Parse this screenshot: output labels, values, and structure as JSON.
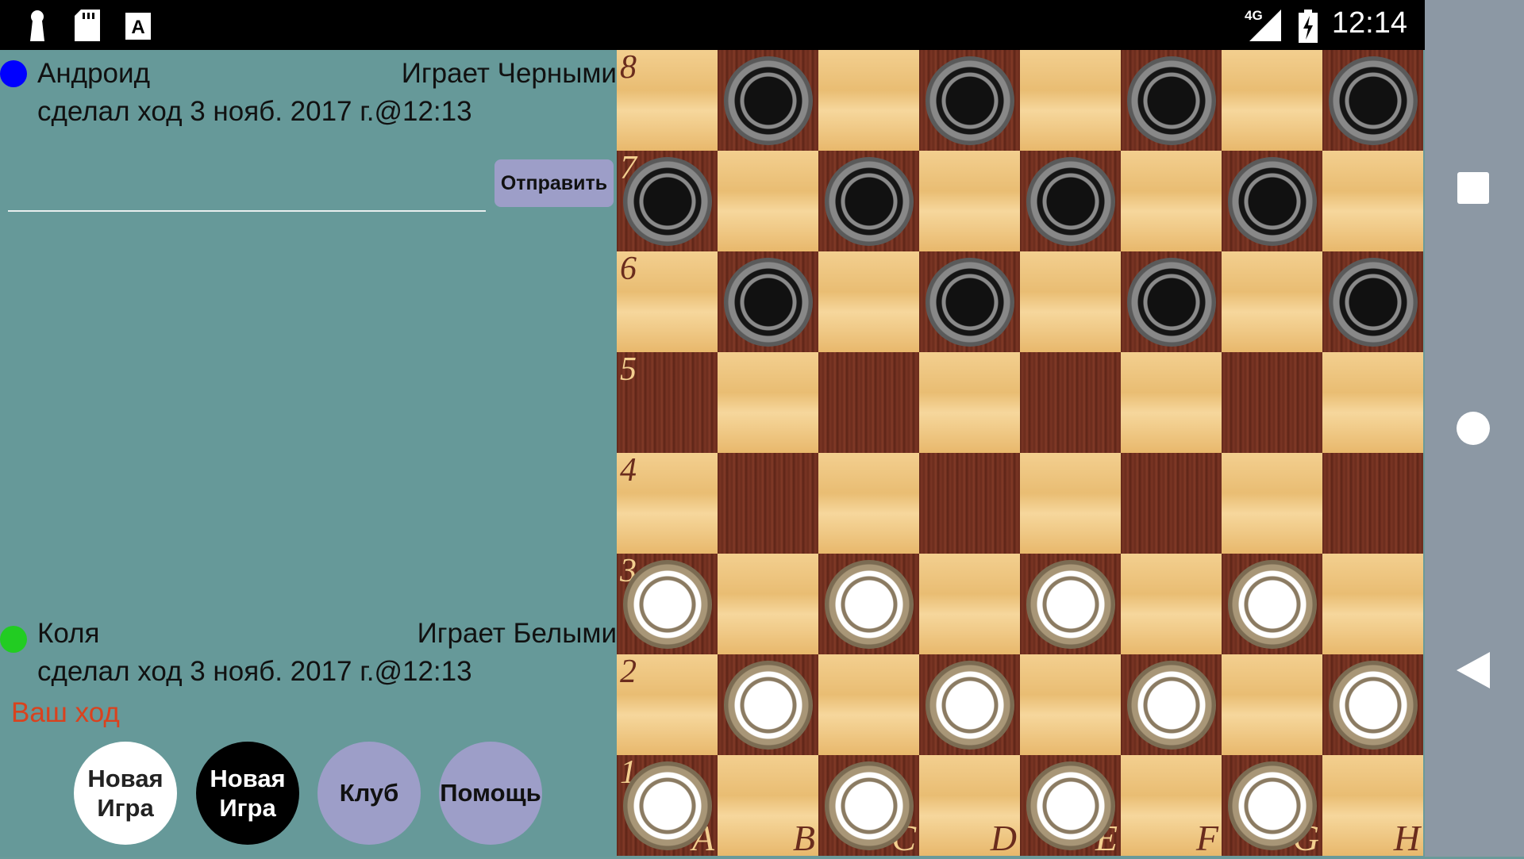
{
  "status_bar": {
    "time": "12:14",
    "network": "4G",
    "icons": [
      "keyhole-icon",
      "sd-card-icon",
      "font-a-icon",
      "signal-icon",
      "battery-charging-icon"
    ]
  },
  "nav_bar": {
    "icons": [
      "square-recent-icon",
      "circle-home-icon",
      "triangle-back-icon"
    ]
  },
  "opponent": {
    "name": "Андроид",
    "color_text": "Играет Черными",
    "last_move": "сделал ход 3 нояб. 2017 г.@12:13",
    "dot_color": "#0000ff"
  },
  "chat": {
    "input_value": "",
    "send_label": "Отправить"
  },
  "player": {
    "name": "Коля",
    "color_text": "Играет Белыми",
    "last_move": "сделал ход 3 нояб. 2017 г.@12:13",
    "dot_color": "#22cc22",
    "turn_text": "Ваш ход"
  },
  "buttons": {
    "new_game_white": [
      "Новая",
      "Игра"
    ],
    "new_game_black": [
      "Новая",
      "Игра"
    ],
    "club": "Клуб",
    "help": "Помощь"
  },
  "board": {
    "ranks": [
      "8",
      "7",
      "6",
      "5",
      "4",
      "3",
      "2",
      "1"
    ],
    "files": [
      "A",
      "B",
      "C",
      "D",
      "E",
      "F",
      "G",
      "H"
    ],
    "pieces": [
      {
        "sq": "b8",
        "color": "black"
      },
      {
        "sq": "d8",
        "color": "black"
      },
      {
        "sq": "f8",
        "color": "black"
      },
      {
        "sq": "h8",
        "color": "black"
      },
      {
        "sq": "a7",
        "color": "black"
      },
      {
        "sq": "c7",
        "color": "black"
      },
      {
        "sq": "e7",
        "color": "black"
      },
      {
        "sq": "g7",
        "color": "black"
      },
      {
        "sq": "b6",
        "color": "black"
      },
      {
        "sq": "d6",
        "color": "black"
      },
      {
        "sq": "f6",
        "color": "black"
      },
      {
        "sq": "h6",
        "color": "black"
      },
      {
        "sq": "a3",
        "color": "white"
      },
      {
        "sq": "c3",
        "color": "white"
      },
      {
        "sq": "e3",
        "color": "white"
      },
      {
        "sq": "g3",
        "color": "white"
      },
      {
        "sq": "b2",
        "color": "white"
      },
      {
        "sq": "d2",
        "color": "white"
      },
      {
        "sq": "f2",
        "color": "white"
      },
      {
        "sq": "h2",
        "color": "white"
      },
      {
        "sq": "a1",
        "color": "white"
      },
      {
        "sq": "c1",
        "color": "white"
      },
      {
        "sq": "e1",
        "color": "white"
      },
      {
        "sq": "g1",
        "color": "white"
      }
    ]
  }
}
